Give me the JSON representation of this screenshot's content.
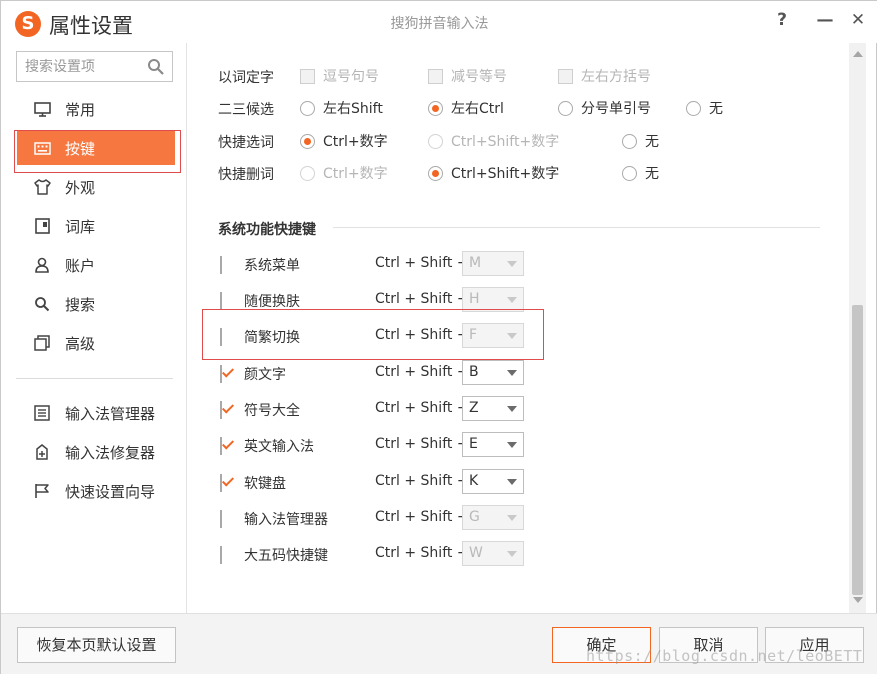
{
  "titlebar": {
    "logo_letter": "S",
    "title": "属性设置",
    "subtitle": "搜狗拼音输入法",
    "help": "?",
    "minimize": "—",
    "close": "✕"
  },
  "sidebar": {
    "search_placeholder": "搜索设置项",
    "items": [
      {
        "label": "常用",
        "icon": "monitor-icon"
      },
      {
        "label": "按键",
        "icon": "keyboard-icon",
        "active": true
      },
      {
        "label": "外观",
        "icon": "shirt-icon"
      },
      {
        "label": "词库",
        "icon": "book-icon"
      },
      {
        "label": "账户",
        "icon": "user-icon"
      },
      {
        "label": "搜索",
        "icon": "search-icon"
      },
      {
        "label": "高级",
        "icon": "square-stack-icon"
      }
    ],
    "tools": [
      {
        "label": "输入法管理器",
        "icon": "list-icon"
      },
      {
        "label": "输入法修复器",
        "icon": "repair-icon"
      },
      {
        "label": "快速设置向导",
        "icon": "flag-icon"
      }
    ]
  },
  "options": {
    "word_select": {
      "label": "以词定字",
      "choices": [
        "逗号句号",
        "减号等号",
        "左右方括号"
      ]
    },
    "second_third": {
      "label": "二三候选",
      "choices": [
        "左右Shift",
        "左右Ctrl",
        "分号单引号",
        "无"
      ],
      "selected": "左右Ctrl"
    },
    "quick_select": {
      "label": "快捷选词",
      "choices": [
        "Ctrl+数字",
        "Ctrl+Shift+数字",
        "无"
      ],
      "selected": "Ctrl+数字"
    },
    "quick_delete": {
      "label": "快捷删词",
      "choices": [
        "Ctrl+数字",
        "Ctrl+Shift+数字",
        "无"
      ],
      "selected": "Ctrl+Shift+数字"
    }
  },
  "hotkeys": {
    "section_title": "系统功能快捷键",
    "modifier": "Ctrl + Shift +",
    "rows": [
      {
        "name": "系统菜单",
        "checked": false,
        "key": "M"
      },
      {
        "name": "随便换肤",
        "checked": false,
        "key": "H"
      },
      {
        "name": "简繁切换",
        "checked": false,
        "key": "F"
      },
      {
        "name": "颜文字",
        "checked": true,
        "key": "B"
      },
      {
        "name": "符号大全",
        "checked": true,
        "key": "Z"
      },
      {
        "name": "英文输入法",
        "checked": true,
        "key": "E"
      },
      {
        "name": "软键盘",
        "checked": true,
        "key": "K"
      },
      {
        "name": "输入法管理器",
        "checked": false,
        "key": "G"
      },
      {
        "name": "大五码快捷键",
        "checked": false,
        "key": "W"
      }
    ]
  },
  "footer": {
    "restore": "恢复本页默认设置",
    "ok": "确定",
    "cancel": "取消",
    "apply": "应用",
    "watermark": "https://blog.csdn.net/leoBETT"
  },
  "colors": {
    "accent": "#f26522",
    "active_nav": "#f6773f",
    "highlight_box": "#e04b4b"
  }
}
